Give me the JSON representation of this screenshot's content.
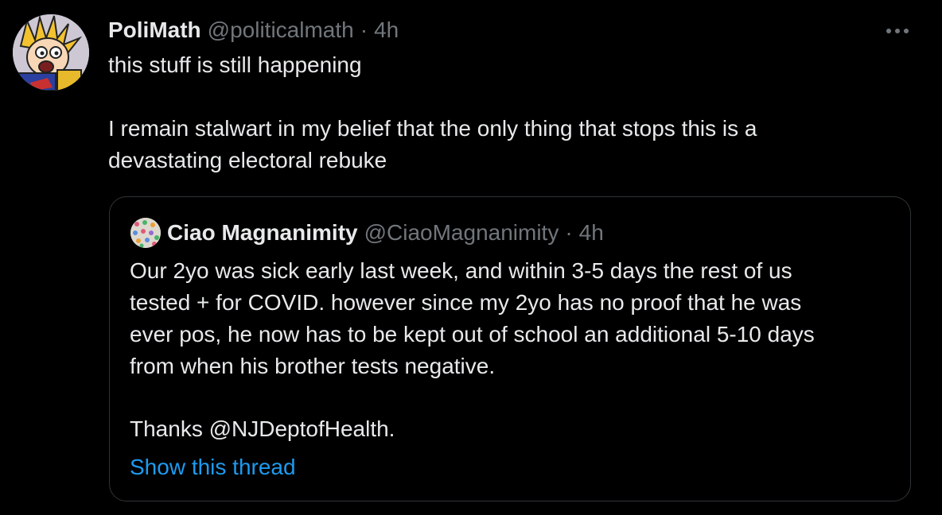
{
  "tweet": {
    "display_name": "PoliMath",
    "handle": "@politicalmath",
    "separator": "·",
    "time": "4h",
    "more_label": "More",
    "text_lines": [
      "this stuff is still happening",
      "I remain stalwart in my belief that the only thing that stops this is a",
      "devastating electoral rebuke"
    ]
  },
  "quoted_tweet": {
    "display_name": "Ciao Magnanimity",
    "handle": "@CiaoMagnanimity",
    "separator": "·",
    "time": "4h",
    "text_lines": [
      "Our 2yo was sick early last week, and within 3-5 days the rest of us",
      "tested + for COVID. however since my 2yo has no proof that he was",
      "ever pos, he now has to be kept out of school an additional 5-10 days",
      "from when his brother tests negative.",
      "Thanks @NJDeptofHealth."
    ],
    "show_thread_label": "Show this thread"
  },
  "icons": {
    "more": "more-horizontal-icon"
  },
  "colors": {
    "background": "#000000",
    "primary_text": "#e7e9ea",
    "secondary_text": "#71767b",
    "link": "#1d9bf0",
    "border": "#2f3336"
  }
}
